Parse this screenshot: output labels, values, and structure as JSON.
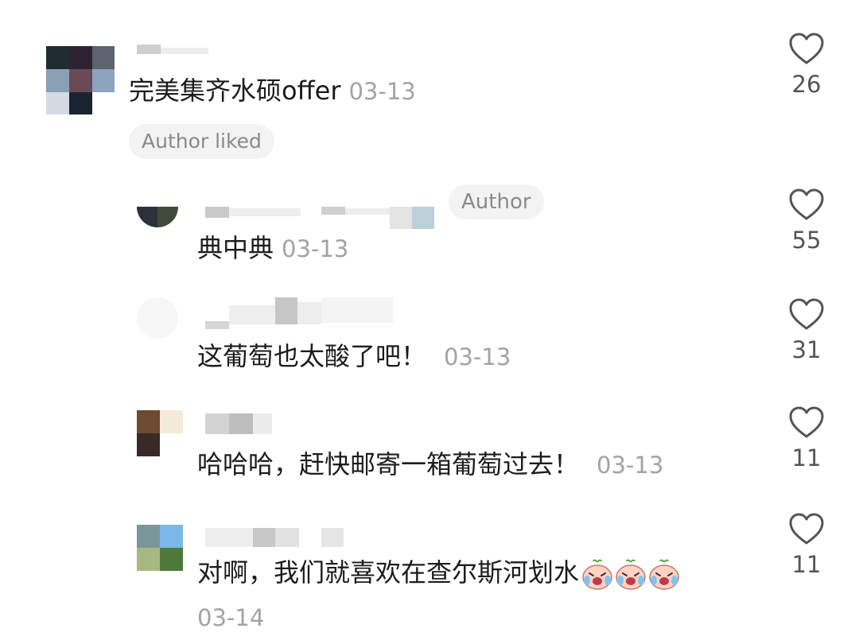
{
  "comments": [
    {
      "level": "top",
      "text": "完美集齐水硕offer",
      "date": "03-13",
      "likes": "26",
      "badge": "Author liked",
      "avatar_colors": [
        "#1f2d33",
        "#2d2230",
        "#5c6470",
        "#8aa0b5",
        "#6b4a57",
        "#8ca4be",
        "#d5dbe2",
        "#1a2430",
        "#ffffff"
      ]
    },
    {
      "level": "reply",
      "text": "典中典",
      "date": "03-13",
      "likes": "55",
      "badge": "Author"
    },
    {
      "level": "reply",
      "text": "这葡萄也太酸了吧！",
      "date": "03-13",
      "likes": "31"
    },
    {
      "level": "reply",
      "text": "哈哈哈，赶快邮寄一箱葡萄过去！",
      "date": "03-13",
      "likes": "11"
    },
    {
      "level": "reply",
      "text": "对啊，我们就喜欢在查尔斯河划水",
      "date": "03-14",
      "likes": "11",
      "emoji": [
        "crying-face-emoji",
        "crying-face-emoji",
        "crying-face-emoji"
      ]
    }
  ],
  "colors": {
    "text": "#1c1c1c",
    "date": "#a3a3a3",
    "like_icon": "#555555",
    "pill_bg": "#f3f3f3",
    "pill_text": "#8a8a8a"
  },
  "icons": {
    "like": "heart-outline-icon"
  }
}
